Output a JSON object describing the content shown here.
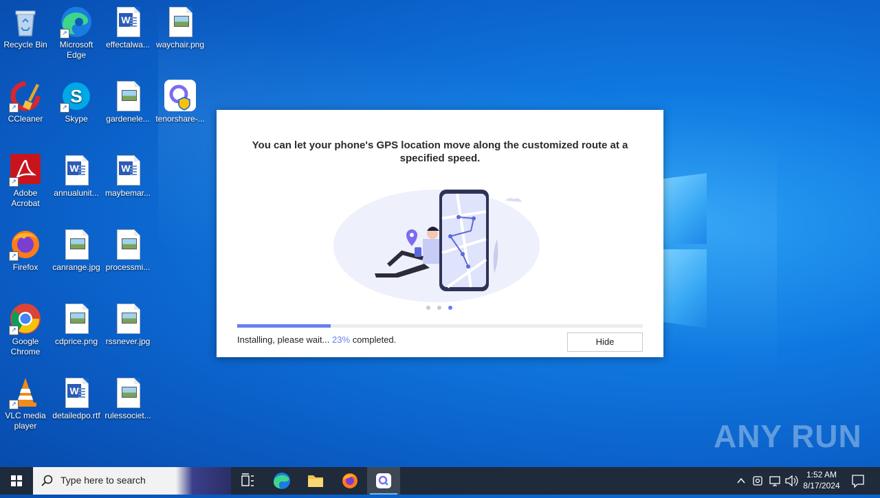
{
  "desktop": {
    "icons": [
      {
        "label": "Recycle Bin",
        "icon": "recycle-bin-icon"
      },
      {
        "label": "Microsoft Edge",
        "icon": "edge-icon"
      },
      {
        "label": "effectalwa...",
        "icon": "word-doc-icon"
      },
      {
        "label": "waychair.png",
        "icon": "image-file-icon"
      },
      {
        "label": "CCleaner",
        "icon": "ccleaner-icon"
      },
      {
        "label": "Skype",
        "icon": "skype-icon"
      },
      {
        "label": "gardenele...",
        "icon": "image-file-icon"
      },
      {
        "label": "tenorshare-...",
        "icon": "tenorshare-icon"
      },
      {
        "label": "Adobe Acrobat",
        "icon": "acrobat-icon"
      },
      {
        "label": "annualunit...",
        "icon": "word-doc-icon"
      },
      {
        "label": "maybemar...",
        "icon": "word-doc-icon"
      },
      {
        "label": "Firefox",
        "icon": "firefox-icon"
      },
      {
        "label": "canrange.jpg",
        "icon": "image-file-icon"
      },
      {
        "label": "processmi...",
        "icon": "image-file-icon"
      },
      {
        "label": "Google Chrome",
        "icon": "chrome-icon"
      },
      {
        "label": "cdprice.png",
        "icon": "image-file-icon"
      },
      {
        "label": "rssnever.jpg",
        "icon": "image-file-icon"
      },
      {
        "label": "VLC media player",
        "icon": "vlc-icon"
      },
      {
        "label": "detailedpo.rtf",
        "icon": "word-doc-icon"
      },
      {
        "label": "rulessociet...",
        "icon": "image-file-icon"
      }
    ]
  },
  "dialog": {
    "title": "You can let your phone's GPS location move along the customized route at a specified speed.",
    "status_prefix": "Installing, please wait...",
    "progress_text": "23%",
    "status_suffix": "completed.",
    "progress_fraction": 0.23,
    "hide_label": "Hide",
    "carousel_active_index": 2,
    "accent_color": "#6b7ff0"
  },
  "watermark": "ANY RUN",
  "taskbar": {
    "search_placeholder": "Type here to search",
    "time": "1:52 AM",
    "date": "8/17/2024"
  }
}
